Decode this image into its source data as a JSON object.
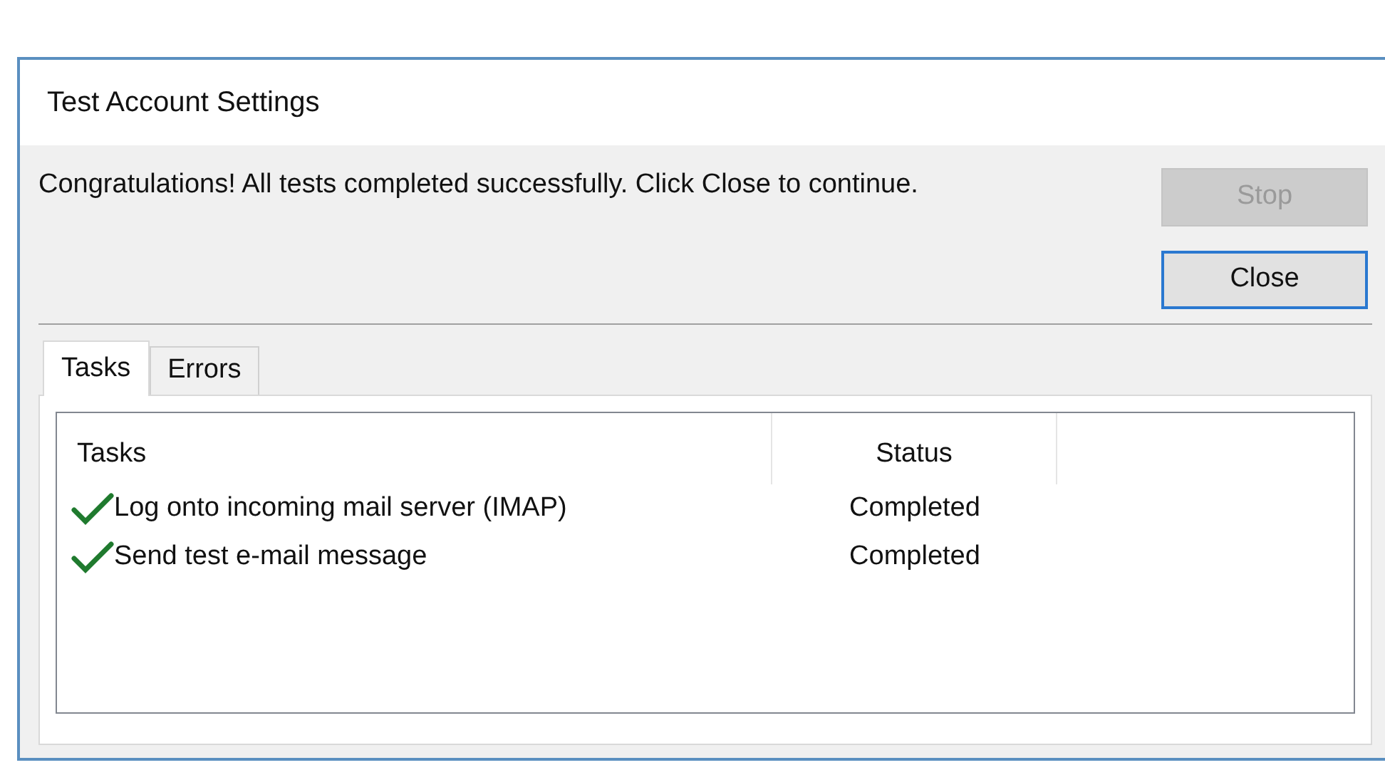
{
  "window": {
    "title": "Test Account Settings"
  },
  "message": "Congratulations! All tests completed successfully. Click Close to continue.",
  "buttons": [
    {
      "label": "Stop",
      "disabled": true,
      "focused": false
    },
    {
      "label": "Close",
      "disabled": false,
      "focused": true
    }
  ],
  "tabs": [
    {
      "label": "Tasks",
      "selected": true
    },
    {
      "label": "Errors",
      "selected": false
    }
  ],
  "table": {
    "columns": [
      "Tasks",
      "Status"
    ],
    "rows": [
      {
        "task": "Log onto incoming mail server (IMAP)",
        "status": "Completed",
        "done": true
      },
      {
        "task": "Send test e-mail message",
        "status": "Completed",
        "done": true
      }
    ]
  }
}
